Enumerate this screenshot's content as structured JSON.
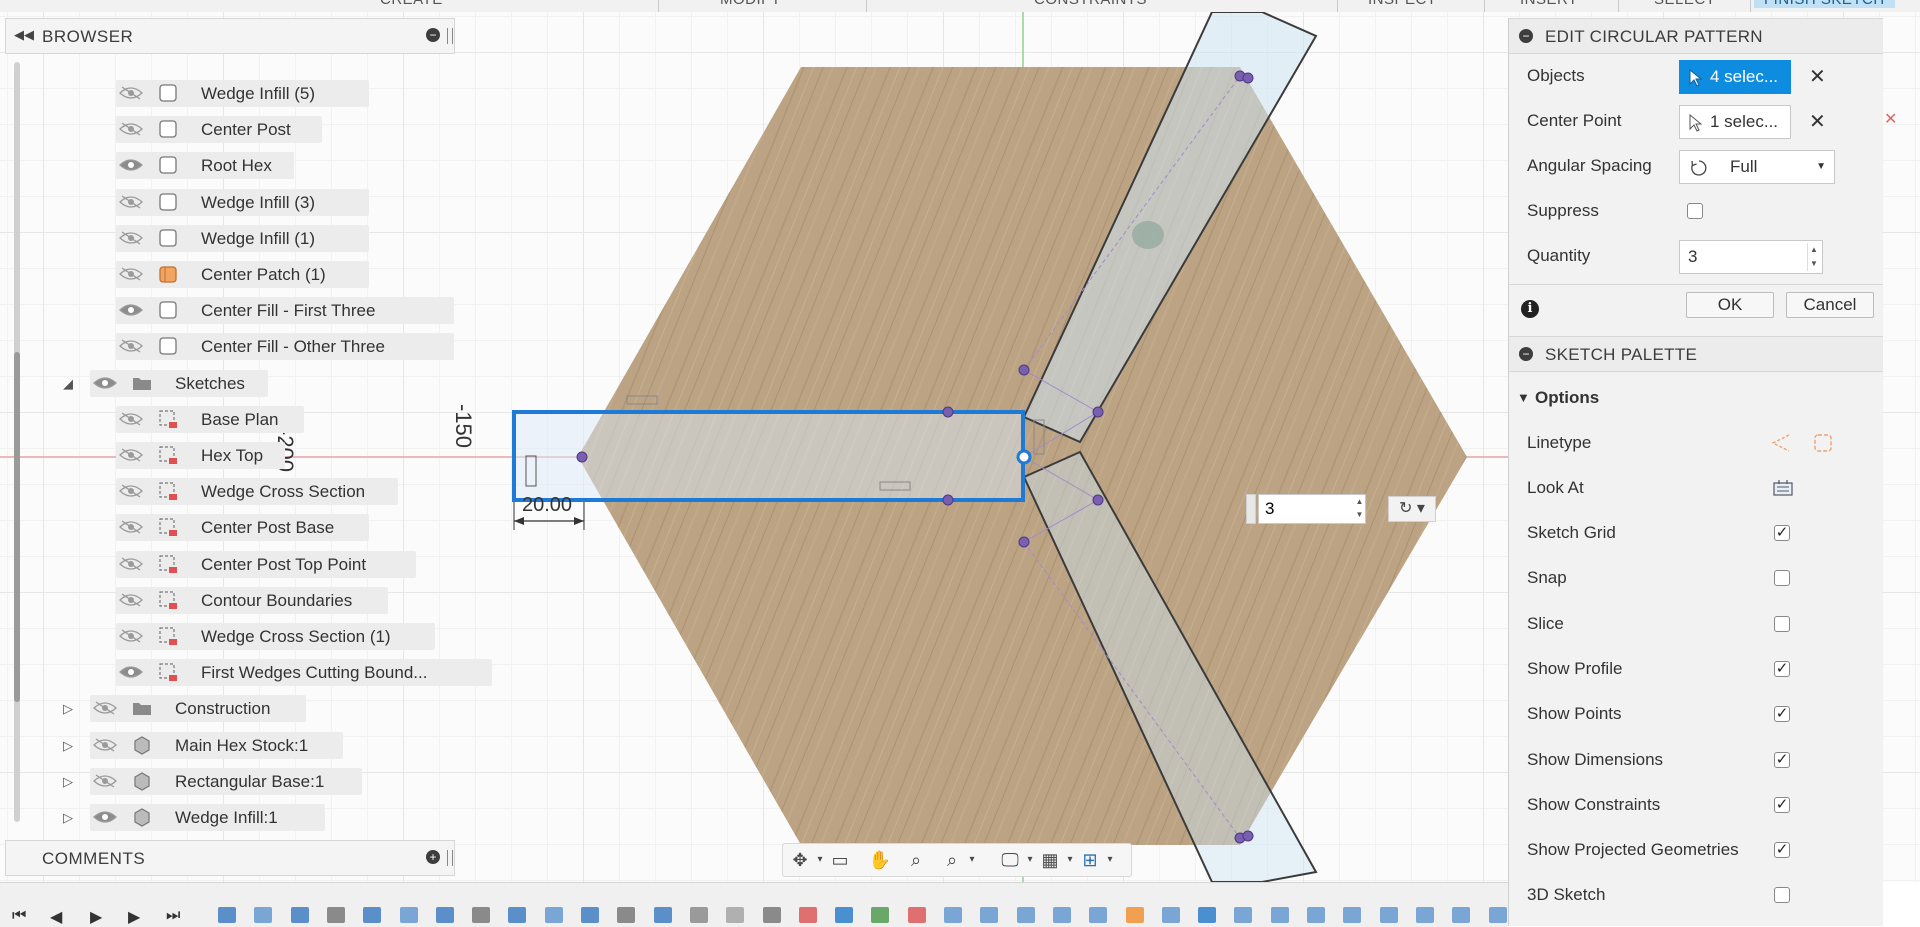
{
  "top_menu": {
    "items": [
      "CREATE",
      "MODIFY",
      "CONSTRAINTS",
      "INSPECT",
      "INSERT",
      "SELECT",
      "FINISH SKETCH"
    ]
  },
  "browser": {
    "title": "BROWSER",
    "items": [
      {
        "label": "Wedge Infill (5)",
        "visible": false,
        "icon": "body-icon",
        "expander": ""
      },
      {
        "label": "Center Post",
        "visible": false,
        "icon": "body-icon",
        "expander": ""
      },
      {
        "label": "Root Hex",
        "visible": true,
        "icon": "body-icon",
        "expander": ""
      },
      {
        "label": "Wedge Infill (3)",
        "visible": false,
        "icon": "body-icon",
        "expander": ""
      },
      {
        "label": "Wedge Infill (1)",
        "visible": false,
        "icon": "body-icon",
        "expander": ""
      },
      {
        "label": "Center Patch (1)",
        "visible": false,
        "icon": "patch-body-icon",
        "expander": ""
      },
      {
        "label": "Center Fill - First Three",
        "visible": true,
        "icon": "body-icon",
        "expander": ""
      },
      {
        "label": "Center Fill - Other Three",
        "visible": false,
        "icon": "body-icon",
        "expander": ""
      },
      {
        "label": "Sketches",
        "visible": true,
        "icon": "folder-icon",
        "expander": "◢"
      },
      {
        "label": "Base Plan",
        "visible": false,
        "icon": "sketch-icon",
        "expander": ""
      },
      {
        "label": "Hex Top",
        "visible": false,
        "icon": "sketch-icon",
        "expander": ""
      },
      {
        "label": "Wedge Cross Section",
        "visible": false,
        "icon": "sketch-icon",
        "expander": ""
      },
      {
        "label": "Center Post Base",
        "visible": false,
        "icon": "sketch-icon",
        "expander": ""
      },
      {
        "label": "Center Post Top Point",
        "visible": false,
        "icon": "sketch-icon",
        "expander": ""
      },
      {
        "label": "Contour Boundaries",
        "visible": false,
        "icon": "sketch-icon",
        "expander": ""
      },
      {
        "label": "Wedge Cross Section (1)",
        "visible": false,
        "icon": "sketch-icon",
        "expander": ""
      },
      {
        "label": "First Wedges Cutting Bound...",
        "visible": true,
        "icon": "sketch-icon",
        "expander": ""
      },
      {
        "label": "Construction",
        "visible": false,
        "icon": "folder-icon",
        "expander": "▷"
      },
      {
        "label": "Main Hex Stock:1",
        "visible": false,
        "icon": "component-icon",
        "expander": "▷"
      },
      {
        "label": "Rectangular Base:1",
        "visible": false,
        "icon": "component-icon",
        "expander": "▷"
      },
      {
        "label": "Wedge Infill:1",
        "visible": true,
        "icon": "component-icon",
        "expander": "▷"
      }
    ]
  },
  "comments": {
    "title": "COMMENTS"
  },
  "canvas": {
    "ruler_labels": [
      "-200",
      "-150"
    ],
    "dimension_label": "20.00",
    "inline_quantity": "3"
  },
  "edit_circular_pattern": {
    "title": "EDIT CIRCULAR PATTERN",
    "objects_label": "Objects",
    "objects_value": "4 selec...",
    "center_point_label": "Center Point",
    "center_point_value": "1 selec...",
    "angular_spacing_label": "Angular Spacing",
    "angular_spacing_value": "Full",
    "suppress_label": "Suppress",
    "suppress_checked": false,
    "quantity_label": "Quantity",
    "quantity_value": "3",
    "ok_label": "OK",
    "cancel_label": "Cancel"
  },
  "sketch_palette": {
    "title": "SKETCH PALETTE",
    "options_label": "Options",
    "linetype_label": "Linetype",
    "look_at_label": "Look At",
    "options": [
      {
        "label": "Sketch Grid",
        "checked": true
      },
      {
        "label": "Snap",
        "checked": false
      },
      {
        "label": "Slice",
        "checked": false
      },
      {
        "label": "Show Profile",
        "checked": true
      },
      {
        "label": "Show Points",
        "checked": true
      },
      {
        "label": "Show Dimensions",
        "checked": true
      },
      {
        "label": "Show Constraints",
        "checked": true
      },
      {
        "label": "Show Projected Geometries",
        "checked": true
      },
      {
        "label": "3D Sketch",
        "checked": false
      }
    ]
  },
  "colors": {
    "accent": "#0e8de0",
    "wood": "#b99f7e",
    "selection": "#1f7ad6",
    "axis_red": "#e8a3a3",
    "axis_green": "#8fd28f"
  }
}
